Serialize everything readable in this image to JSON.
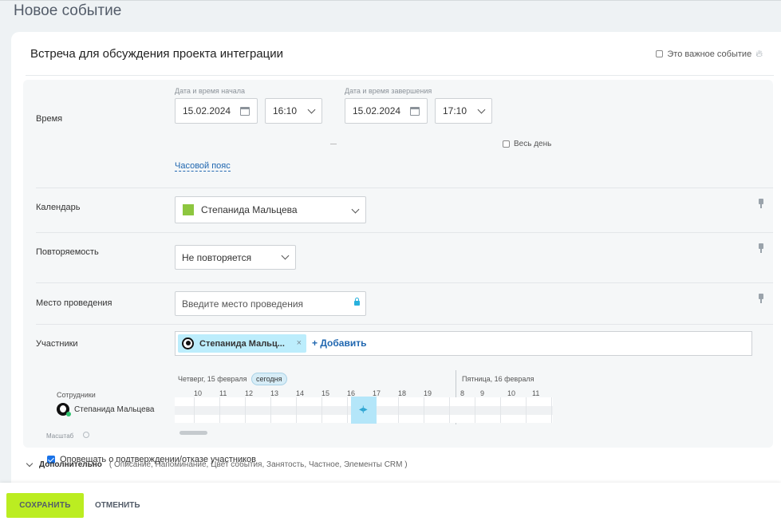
{
  "page": {
    "title": "Новое событие"
  },
  "event": {
    "title": "Встреча для обсуждения проекта интеграции",
    "important_label": "Это важное событие"
  },
  "time": {
    "label": "Время",
    "start_label": "Дата и время начала",
    "end_label": "Дата и время завершения",
    "start_date": "15.02.2024",
    "start_time": "16:10",
    "end_date": "15.02.2024",
    "end_time": "17:10",
    "all_day_label": "Весь день",
    "timezone_link": "Часовой пояс"
  },
  "calendar": {
    "label": "Календарь",
    "value": "Степанида Мальцева",
    "color": "#8dc63f"
  },
  "repeat": {
    "label": "Повторяемость",
    "value": "Не повторяется"
  },
  "location": {
    "label": "Место проведения",
    "placeholder": "Введите место проведения"
  },
  "participants": {
    "label": "Участники",
    "chip": "Степанида Мальц...",
    "add_label": "+ Добавить"
  },
  "planner": {
    "employees_label": "Сотрудники",
    "employee": "Степанида Мальцева",
    "day1": "Четверг, 15 февраля",
    "today_badge": "сегодня",
    "day2": "Пятница, 16 февраля",
    "hours_day1": [
      "10",
      "11",
      "12",
      "13",
      "14",
      "15",
      "16",
      "17",
      "18",
      "19"
    ],
    "hours_day2": [
      "8",
      "9",
      "10",
      "11"
    ],
    "scale_label": "Масштаб"
  },
  "notify": {
    "label": "Оповещать о подтверждении/отказе участников",
    "checked": true
  },
  "more": {
    "title": "Дополнительно",
    "items": "( Описание,  Напоминание,  Цвет события,  Занятость,  Частное,  Элементы CRM )"
  },
  "footer": {
    "save": "СОХРАНИТЬ",
    "cancel": "ОТМЕНИТЬ"
  }
}
